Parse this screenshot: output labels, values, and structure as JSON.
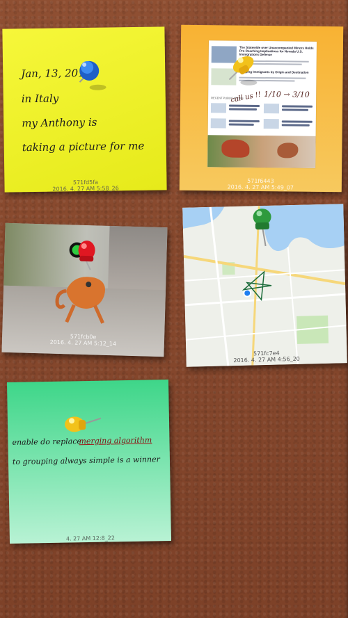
{
  "notes": {
    "yellow": {
      "lines": [
        "Jan, 13, 2013",
        "in Italy",
        "my Anthony is",
        "taking a picture for me"
      ],
      "stamp_id": "571fd5fa",
      "stamp_time": "2016. 4. 27 AM 5:58_26",
      "pin_color": "blue"
    },
    "orange": {
      "stamp_id": "571f6443",
      "stamp_time": "2016. 4. 27 AM 5:49_07",
      "pin_color": "yellow",
      "handwriting": "1/10 → 3/10",
      "handwriting2": "call us !!",
      "article": {
        "headline1": "The Statewide over Unaccompanied Minors Holds Pro Reaching Implications for Nevada U.S. Immigrations Defense",
        "headline2": "Mapping Immigrants by Origin and Destination",
        "section": "RECENT PUBLICATIONS"
      }
    },
    "photo": {
      "stamp_id": "571fcb0e",
      "stamp_time": "2016. 4. 27 AM 5:12_14",
      "pin_color": "red"
    },
    "map": {
      "stamp_id": "571fc7e4",
      "stamp_time": "2016. 4. 27 AM 4:56_20",
      "pin_color": "green"
    },
    "green": {
      "line1_a": "enable do replace",
      "line1_b": "merging algorithm",
      "line2": "to grouping always simple is a winner",
      "stamp_time": "4. 27 AM 12:8_22",
      "pin_color": "yellow"
    }
  }
}
